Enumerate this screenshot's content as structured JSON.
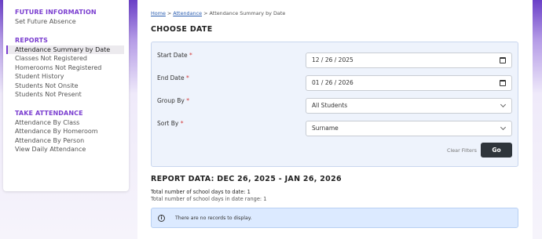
{
  "sidebar": {
    "sections": [
      {
        "heading": "FUTURE INFORMATION",
        "items": [
          "Set Future Absence"
        ]
      },
      {
        "heading": "REPORTS",
        "items": [
          "Attendance Summary by Date",
          "Classes Not Registered",
          "Homerooms Not Registered",
          "Student History",
          "Students Not Onsite",
          "Students Not Present"
        ]
      },
      {
        "heading": "TAKE ATTENDANCE",
        "items": [
          "Attendance By Class",
          "Attendance By Homeroom",
          "Attendance By Person",
          "View Daily Attendance"
        ]
      }
    ],
    "active_item": "Attendance Summary by Date"
  },
  "breadcrumb": {
    "home": "Home",
    "sep1": " > ",
    "attendance": "Attendance",
    "sep2": " > ",
    "current": "Attendance Summary by Date"
  },
  "choose": {
    "title": "CHOOSE DATE",
    "start_label": "Start Date",
    "start_value": "12 / 26 / 2025",
    "end_label": "End Date",
    "end_value": "01 / 26 / 2026",
    "group_label": "Group By",
    "group_value": "All Students",
    "sort_label": "Sort By",
    "sort_value": "Surname",
    "required_mark": "*",
    "clear_label": "Clear Filters",
    "go_label": "Go"
  },
  "report": {
    "title": "REPORT DATA: DEC 26, 2025 - JAN 26, 2026",
    "total_to_date": "Total number of school days to date: 1",
    "total_in_range": "Total number of school days in date range: 1",
    "no_records": "There are no records to display.",
    "info_icon": "i"
  },
  "colors": {
    "accent": "#7b3fd0",
    "go_button": "#2f353b",
    "panel": "#eef3fc",
    "alert": "#dceaff"
  }
}
